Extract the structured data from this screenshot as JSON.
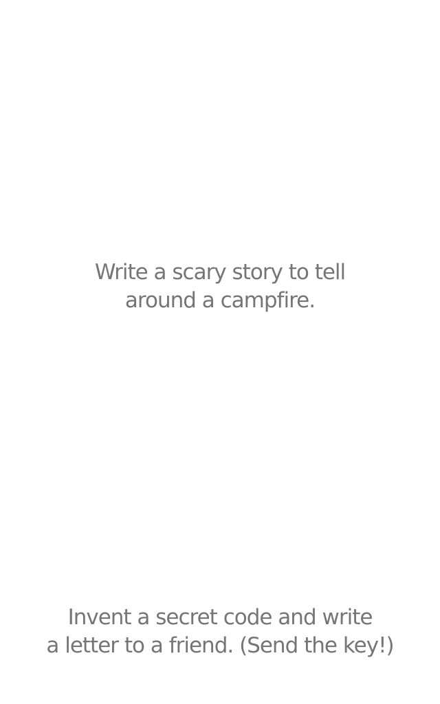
{
  "prompts": [
    {
      "lines": [
        "Write a scary story to tell",
        "around a campfire."
      ]
    },
    {
      "lines": [
        "Invent a secret code and write",
        "a letter to a friend. (Send the key!)"
      ]
    }
  ],
  "colors": {
    "background": "#ffffff",
    "text": "#757575"
  }
}
